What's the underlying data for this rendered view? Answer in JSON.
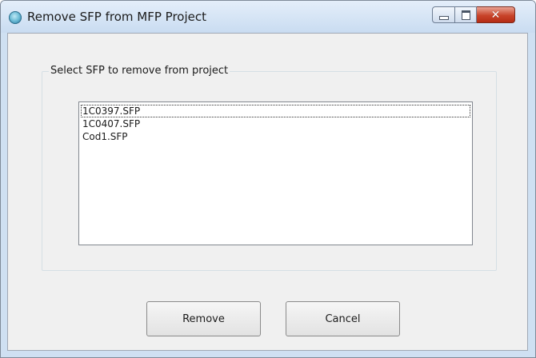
{
  "window": {
    "title": "Remove SFP from MFP Project",
    "icon": "app-globe-icon",
    "controls": {
      "minimize": "minimize-icon",
      "maximize": "maximize-icon",
      "close": "close-icon"
    },
    "colors": {
      "close_button": "#c8442a",
      "client_background": "#f0f0f0",
      "frame": "#cfe0f2"
    }
  },
  "group": {
    "label": "Select SFP to remove from project"
  },
  "list": {
    "items": [
      "1C0397.SFP",
      "1C0407.SFP",
      "Cod1.SFP"
    ],
    "focused_index": 0
  },
  "buttons": {
    "remove": "Remove",
    "cancel": "Cancel"
  }
}
